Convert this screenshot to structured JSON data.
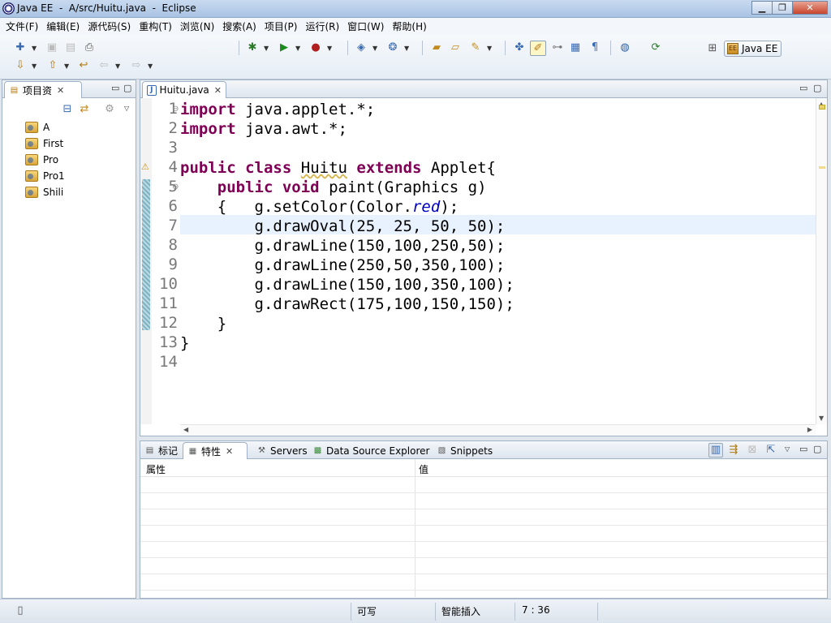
{
  "window": {
    "title": "Java EE  -  A/src/Huitu.java  -  Eclipse",
    "minimize_label": "▁",
    "maximize_label": "❐",
    "close_label": "✕"
  },
  "menubar": {
    "items": [
      {
        "label": "文件(F)"
      },
      {
        "label": "编辑(E)"
      },
      {
        "label": "源代码(S)"
      },
      {
        "label": "重构(T)"
      },
      {
        "label": "浏览(N)"
      },
      {
        "label": "搜索(A)"
      },
      {
        "label": "项目(P)"
      },
      {
        "label": "运行(R)"
      },
      {
        "label": "窗口(W)"
      },
      {
        "label": "帮助(H)"
      }
    ]
  },
  "perspective": {
    "label": "Java EE",
    "icon": "javaee-perspective-icon"
  },
  "project_explorer": {
    "tab_label": "项目资",
    "close_label": "✕",
    "projects": [
      {
        "name": "A"
      },
      {
        "name": "First"
      },
      {
        "name": "Pro"
      },
      {
        "name": "Pro1"
      },
      {
        "name": "Shili"
      }
    ]
  },
  "editor": {
    "tab_label": "Huitu.java",
    "close_label": "✕",
    "current_line": 7,
    "line_numbers": [
      "1",
      "2",
      "3",
      "4",
      "5",
      "6",
      "7",
      "8",
      "9",
      "10",
      "11",
      "12",
      "13",
      "14"
    ],
    "fold_marker": "⊖",
    "code": {
      "l1_kw": "import",
      "l1_rest": " java.applet.*;",
      "l2_kw": "import",
      "l2_rest": " java.awt.*;",
      "l4_kw1": "public",
      "l4_kw2": "class",
      "l4_name": "Huitu",
      "l4_kw3": "extends",
      "l4_rest": " Applet{",
      "l5_indent": "    ",
      "l5_kw1": "public",
      "l5_kw2": "void",
      "l5_rest": " paint(Graphics g)",
      "l6_pre": "    {   g.setColor(Color.",
      "l6_field": "red",
      "l6_post": ");",
      "l7": "        g.drawOval(25, 25, 50, 50);",
      "l8": "        g.drawLine(150,100,250,50);",
      "l9": "        g.drawLine(250,50,350,100);",
      "l10": "        g.drawLine(150,100,350,100);",
      "l11": "        g.drawRect(175,100,150,150);",
      "l12": "    }",
      "l13": "}",
      "l14": ""
    }
  },
  "bottom_panel": {
    "tabs": [
      {
        "label": "标记",
        "icon": "markers-icon"
      },
      {
        "label": "特性",
        "icon": "properties-icon"
      },
      {
        "label": "Servers",
        "icon": "servers-icon"
      },
      {
        "label": "Data Source Explorer",
        "icon": "data-source-icon"
      },
      {
        "label": "Snippets",
        "icon": "snippets-icon"
      }
    ],
    "active_tab": "特性",
    "close_label": "✕",
    "columns": {
      "property": "属性",
      "value": "值"
    }
  },
  "statusbar": {
    "writable": "可写",
    "insert_mode": "智能插入",
    "position": "7 : 36"
  },
  "colors": {
    "keyword": "#7f0055",
    "static_field": "#0000c0",
    "current_line": "#e8f2fe"
  }
}
